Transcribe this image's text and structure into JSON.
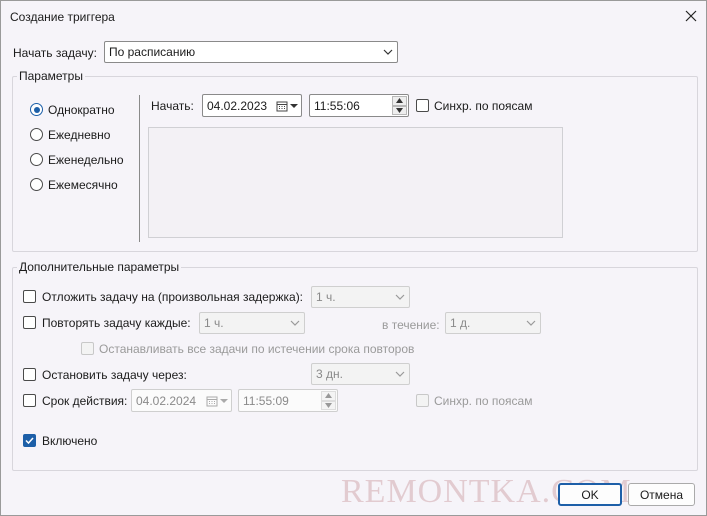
{
  "window": {
    "title": "Создание триггера"
  },
  "start_task": {
    "label": "Начать задачу:",
    "value": "По расписанию"
  },
  "parameters": {
    "title": "Параметры",
    "frequency": [
      {
        "label": "Однократно",
        "checked": true
      },
      {
        "label": "Ежедневно",
        "checked": false
      },
      {
        "label": "Еженедельно",
        "checked": false
      },
      {
        "label": "Ежемесячно",
        "checked": false
      }
    ],
    "start_label": "Начать:",
    "start_date": "04.02.2023",
    "start_time": "11:55:06",
    "sync_label": "Синхр. по поясам"
  },
  "advanced": {
    "title": "Дополнительные параметры",
    "delay_label": "Отложить задачу на (произвольная задержка):",
    "delay_value": "1 ч.",
    "repeat_label": "Повторять задачу каждые:",
    "repeat_value": "1 ч.",
    "duration_label": "в течение:",
    "duration_value": "1 д.",
    "stop_all_label": "Останавливать все задачи по истечении срока повторов",
    "stop_after_label": "Остановить задачу через:",
    "stop_after_value": "3 дн.",
    "expire_label": "Срок действия:",
    "expire_date": "04.02.2024",
    "expire_time": "11:55:09",
    "expire_sync_label": "Синхр. по поясам",
    "enabled_label": "Включено"
  },
  "buttons": {
    "ok": "OK",
    "cancel": "Отмена"
  },
  "watermark": "REMONTKA.COM",
  "colors": {
    "accent": "#1d5fa8",
    "background": "#f6f4f9"
  }
}
